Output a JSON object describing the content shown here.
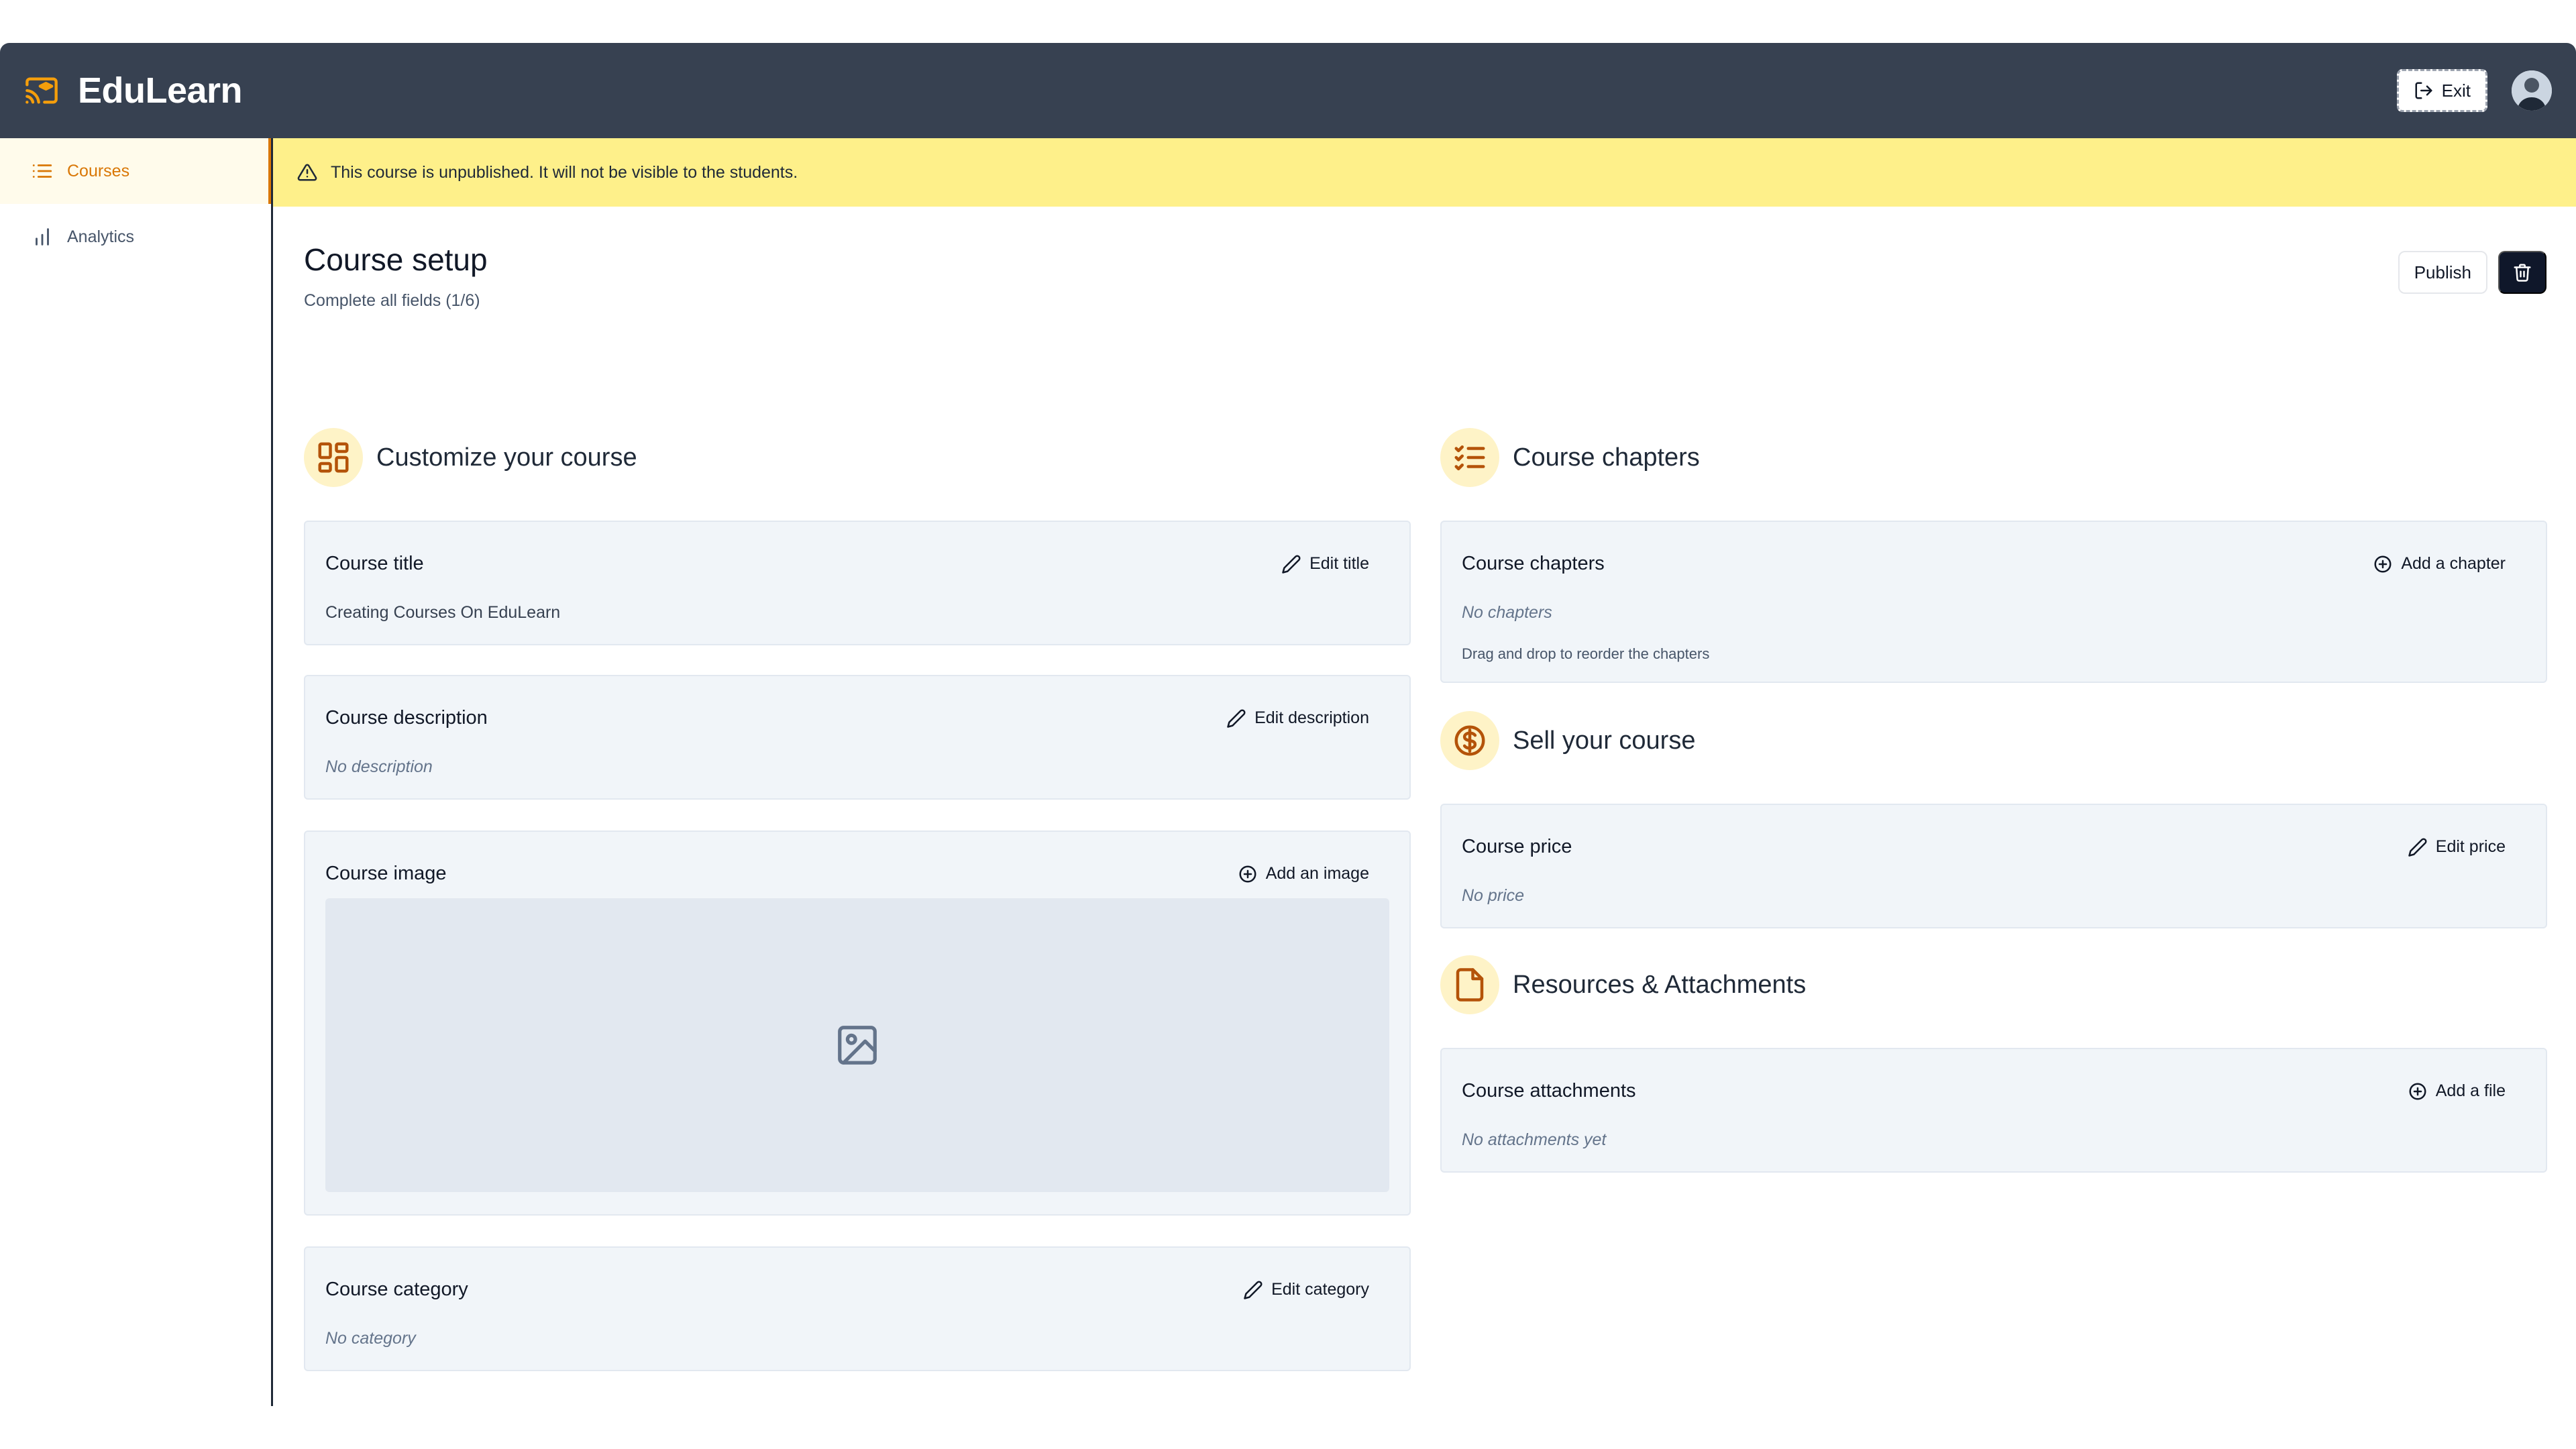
{
  "app": {
    "name": "EduLearn"
  },
  "header": {
    "exit_label": "Exit"
  },
  "sidebar": {
    "items": [
      {
        "label": "Courses",
        "icon": "list-icon",
        "active": true
      },
      {
        "label": "Analytics",
        "icon": "bar-chart-icon",
        "active": false
      }
    ]
  },
  "banner": {
    "text": "This course is unpublished. It will not be visible to the students."
  },
  "page": {
    "title": "Course setup",
    "subtitle": "Complete all fields (1/6)",
    "publish_label": "Publish"
  },
  "sections": {
    "customize": {
      "title": "Customize your course",
      "icon": "layout-dashboard-icon"
    },
    "chapters": {
      "title": "Course chapters",
      "icon": "list-checks-icon"
    },
    "sell": {
      "title": "Sell your course",
      "icon": "circle-dollar-icon"
    },
    "resources": {
      "title": "Resources & Attachments",
      "icon": "file-icon"
    }
  },
  "cards": {
    "title": {
      "label": "Course title",
      "action": "Edit title",
      "value": "Creating Courses On EduLearn"
    },
    "description": {
      "label": "Course description",
      "action": "Edit description",
      "value": "No description"
    },
    "image": {
      "label": "Course image",
      "action": "Add an image"
    },
    "category": {
      "label": "Course category",
      "action": "Edit category",
      "value": "No category"
    },
    "chapters": {
      "label": "Course chapters",
      "action": "Add a chapter",
      "value": "No chapters",
      "hint": "Drag and drop to reorder the chapters"
    },
    "price": {
      "label": "Course price",
      "action": "Edit price",
      "value": "No price"
    },
    "attachments": {
      "label": "Course attachments",
      "action": "Add a file",
      "value": "No attachments yet"
    }
  },
  "colors": {
    "header_bg": "#374151",
    "accent": "#d97706",
    "banner_bg": "#fef08a",
    "card_bg": "#f1f5f9",
    "icon_circle": "#fef3c7"
  }
}
